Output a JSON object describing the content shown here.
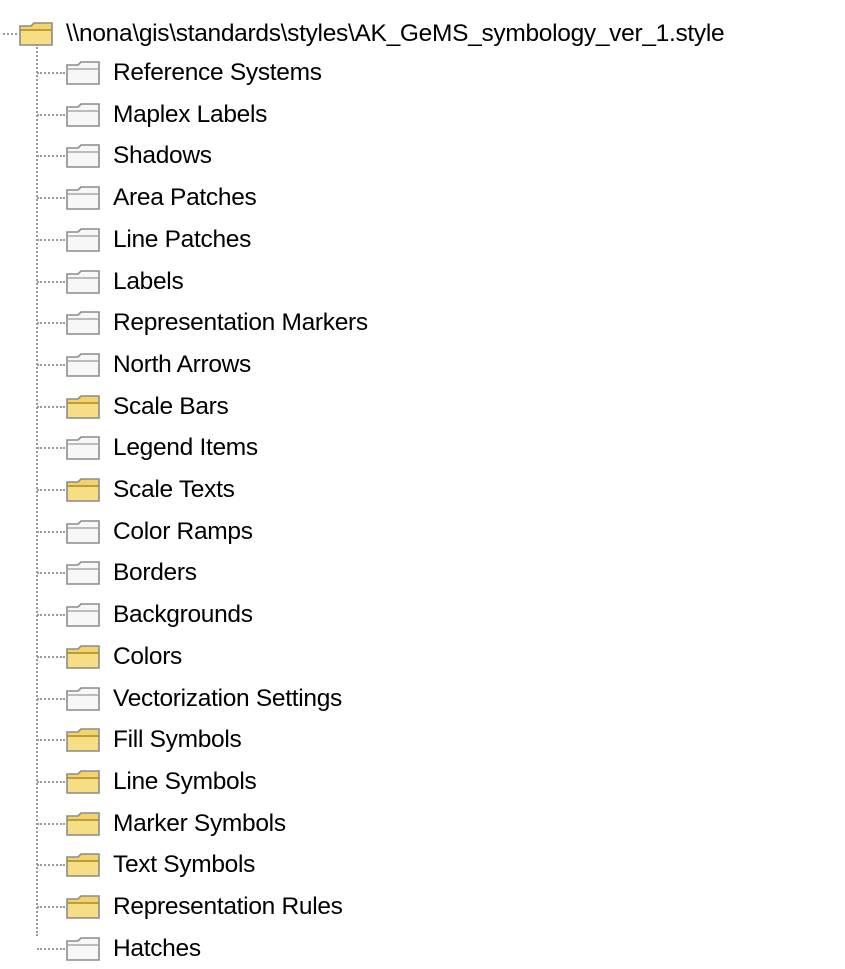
{
  "tree": {
    "root": {
      "label": "\\\\nona\\gis\\standards\\styles\\AK_GeMS_symbology_ver_1.style",
      "icon": "folder-open-icon",
      "color": "#f3d36b"
    },
    "items": [
      {
        "label": "Reference Systems",
        "filled": false
      },
      {
        "label": "Maplex Labels",
        "filled": false
      },
      {
        "label": "Shadows",
        "filled": false
      },
      {
        "label": "Area Patches",
        "filled": false
      },
      {
        "label": "Line Patches",
        "filled": false
      },
      {
        "label": "Labels",
        "filled": false
      },
      {
        "label": "Representation Markers",
        "filled": false
      },
      {
        "label": "North Arrows",
        "filled": false
      },
      {
        "label": "Scale Bars",
        "filled": true
      },
      {
        "label": "Legend Items",
        "filled": false
      },
      {
        "label": "Scale Texts",
        "filled": true
      },
      {
        "label": "Color Ramps",
        "filled": false
      },
      {
        "label": "Borders",
        "filled": false
      },
      {
        "label": "Backgrounds",
        "filled": false
      },
      {
        "label": "Colors",
        "filled": true
      },
      {
        "label": "Vectorization Settings",
        "filled": false
      },
      {
        "label": "Fill Symbols",
        "filled": true
      },
      {
        "label": "Line Symbols",
        "filled": true
      },
      {
        "label": "Marker Symbols",
        "filled": true
      },
      {
        "label": "Text Symbols",
        "filled": true
      },
      {
        "label": "Representation Rules",
        "filled": true
      },
      {
        "label": "Hatches",
        "filled": false
      }
    ]
  },
  "colors": {
    "folder_filled": "#f3d36b",
    "folder_empty": "#f7f7f7",
    "folder_outline": "#8c8c8c",
    "connector": "#9a9a9a"
  }
}
